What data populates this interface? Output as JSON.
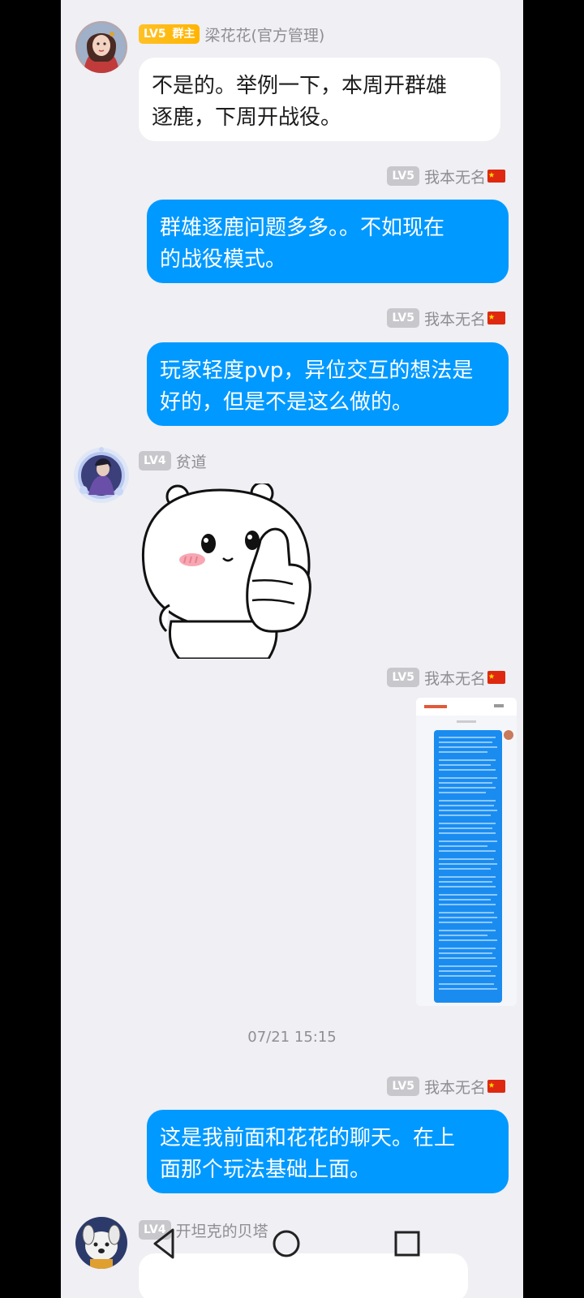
{
  "messages": [
    {
      "sender": "梁花花(官方管理)",
      "level": "LV5",
      "role": "群主",
      "avatar_icon": "female-warrior-avatar",
      "text": "不是的。举例一下，本周开群雄\n逐鹿，下周开战役。"
    },
    {
      "sender": "我本无名",
      "level": "LV5",
      "flag_icon": "china-flag-icon",
      "text": "群雄逐鹿问题多多。。不如现在\n的战役模式。"
    },
    {
      "sender": "我本无名",
      "level": "LV5",
      "flag_icon": "china-flag-icon",
      "text": "玩家轻度pvp，异位交互的想法是\n好的，但是不是这么做的。"
    },
    {
      "sender": "贫道",
      "level": "LV4",
      "avatar_icon": "warrior-avatar-with-frame",
      "sticker": "thumbs-up-bear-sticker"
    },
    {
      "sender": "我本无名",
      "level": "LV5",
      "flag_icon": "china-flag-icon",
      "image": "chat-screenshot-thumbnail"
    },
    {
      "sender": "我本无名",
      "level": "LV5",
      "flag_icon": "china-flag-icon",
      "text": "这是我前面和花花的聊天。在上\n面那个玩法基础上面。"
    },
    {
      "sender": "开坦克的贝塔",
      "level": "LV4",
      "avatar_icon": "dog-avatar"
    }
  ],
  "timestamp": "07/21 15:15",
  "colors": {
    "background": "#efeff4",
    "bubble_self": "#0099ff",
    "bubble_other": "#ffffff",
    "owner_badge": "#ffb400",
    "level_badge": "#c7c7cc"
  },
  "nav": [
    "back-icon",
    "home-icon",
    "recents-icon"
  ]
}
